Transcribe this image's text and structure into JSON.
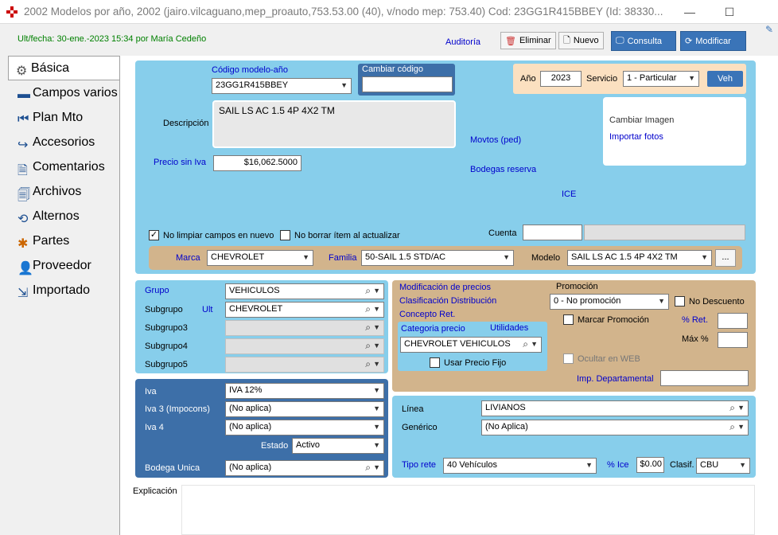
{
  "window": {
    "title": "2002 Modelos por año, 2002 (jairo.vilcaguano,mep_proauto,753.53.00 (40), v/nodo mep: 753.40) Cod: 23GG1R415BBEY (Id: 38330...",
    "minimize": "—",
    "maximize": "☐"
  },
  "header": {
    "ult_fecha": "Ult/fecha: 30-ene.-2023 15:34 por María Cedeño",
    "auditoria": "Auditoría",
    "eliminar": "Eliminar",
    "nuevo": "Nuevo",
    "consulta": "Consulta",
    "modificar": "Modificar"
  },
  "sidebar": {
    "items": [
      {
        "label": "Básica"
      },
      {
        "label": "Campos varios"
      },
      {
        "label": "Plan Mto"
      },
      {
        "label": "Accesorios"
      },
      {
        "label": "Comentarios"
      },
      {
        "label": "Archivos"
      },
      {
        "label": "Alternos"
      },
      {
        "label": "Partes"
      },
      {
        "label": "Proveedor"
      },
      {
        "label": "Importado"
      }
    ]
  },
  "top": {
    "codigo_label": "Código modelo-año",
    "codigo_value": "23GG1R415BBEY",
    "cambiar_codigo_label": "Cambiar código",
    "cambiar_codigo_value": "",
    "ano_label": "Año",
    "ano_value": "2023",
    "servicio_label": "Servicio",
    "servicio_value": "1 - Particular",
    "veh_button": "Veh",
    "descripcion_label": "Descripción",
    "descripcion_value": "SAIL LS AC 1.5 4P 4X2 TM",
    "cambiar_imagen": "Cambiar Imagen",
    "importar_fotos": "Importar fotos",
    "movtos": "Movtos (ped)",
    "bodegas_reserva": "Bodegas reserva",
    "ice": "ICE",
    "precio_label": "Precio sin Iva",
    "precio_value": "$16,062.5000",
    "no_limpiar": "No limpiar campos en nuevo",
    "no_borrar": "No borrar ítem al actualizar",
    "cuenta_label": "Cuenta",
    "cuenta_value": "",
    "marca_label": "Marca",
    "marca_value": "CHEVROLET",
    "familia_label": "Familia",
    "familia_value": "50-SAIL 1.5 STD/AC",
    "modelo_label": "Modelo",
    "modelo_value": "SAIL LS AC 1.5 4P 4X2 TM",
    "ellipsis": "..."
  },
  "grupo": {
    "grupo_label": "Grupo",
    "grupo_value": "VEHICULOS",
    "subgrupo_label": "Subgrupo",
    "ult_label": "Ult",
    "subgrupo_value": "CHEVROLET",
    "subgrupo3_label": "Subgrupo3",
    "subgrupo4_label": "Subgrupo4",
    "subgrupo5_label": "Subgrupo5"
  },
  "iva": {
    "iva_label": "Iva",
    "iva_value": "IVA 12%",
    "iva3_label": "Iva 3 (Impocons)",
    "iva3_value": "(No aplica)",
    "iva4_label": "Iva 4",
    "iva4_value": "(No aplica)",
    "estado_label": "Estado",
    "estado_value": "Activo",
    "bodega_label": "Bodega Unica",
    "bodega_value": "(No aplica)"
  },
  "precios": {
    "modificacion": "Modificación de precios",
    "clasificacion": "Clasificación Distribución",
    "concepto": "Concepto Ret.",
    "categoria_label": "Categoria precio",
    "utilidades": "Utilidades",
    "categoria_value": "CHEVROLET VEHICULOS",
    "usar_precio_fijo": "Usar Precio Fijo",
    "promocion_label": "Promoción",
    "promocion_value": "0 - No promoción",
    "no_descuento": "No Descuento",
    "marcar_promocion": "Marcar Promoción",
    "pct_ret": "% Ret.",
    "max_pct": "Máx %",
    "ocultar_web": "Ocultar en WEB",
    "imp_departamental": "Imp. Departamental"
  },
  "linea": {
    "linea_label": "Línea",
    "linea_value": "LIVIANOS",
    "generico_label": "Genérico",
    "generico_value": "(No Aplica)",
    "tipo_rete_label": "Tipo rete",
    "tipo_rete_value": "40 Vehículos",
    "pct_ice_label": "% Ice",
    "pct_ice_value": "$0.00",
    "clasif_label": "Clasif.",
    "clasif_value": "CBU"
  },
  "explicacion_label": "Explicación"
}
